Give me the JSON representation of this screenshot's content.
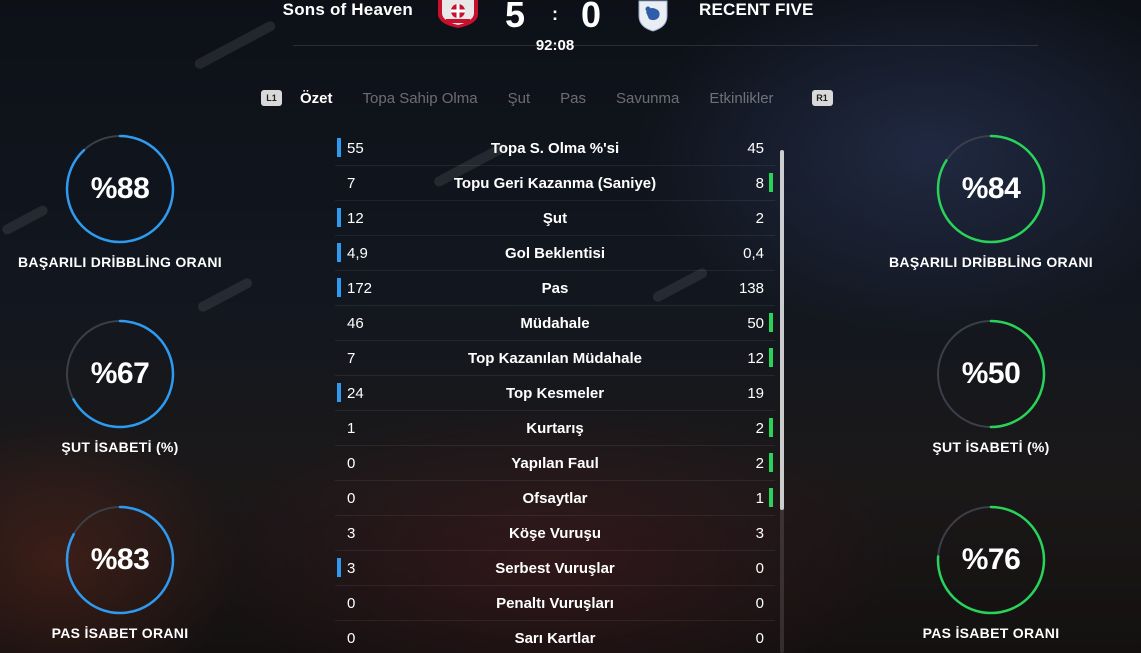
{
  "colors": {
    "home_accent": "#2e9bf0",
    "away_accent": "#29d35a",
    "ring_track": "#3a3f48"
  },
  "header": {
    "home_team": "Sons of Heaven",
    "away_team": "RECENT FIVE",
    "home_score": "5",
    "away_score": "0",
    "separator": ":",
    "clock": "92:08",
    "home_crest_icon": "bayer-leverkusen-crest-icon",
    "away_crest_icon": "shield-crest-icon"
  },
  "tabs": {
    "left_hint": "L1",
    "right_hint": "R1",
    "items": [
      {
        "label": "Özet",
        "active": true
      },
      {
        "label": "Topa Sahip Olma",
        "active": false
      },
      {
        "label": "Şut",
        "active": false
      },
      {
        "label": "Pas",
        "active": false
      },
      {
        "label": "Savunma",
        "active": false
      },
      {
        "label": "Etkinlikler",
        "active": false
      }
    ]
  },
  "home_rings": [
    {
      "value": "%88",
      "percent": 88,
      "label": "BAŞARILI DRİBBLİNG ORANI"
    },
    {
      "value": "%67",
      "percent": 67,
      "label": "ŞUT İSABETİ (%)"
    },
    {
      "value": "%83",
      "percent": 83,
      "label": "PAS İSABET ORANI"
    }
  ],
  "away_rings": [
    {
      "value": "%84",
      "percent": 84,
      "label": "BAŞARILI DRİBBLİNG ORANI"
    },
    {
      "value": "%50",
      "percent": 50,
      "label": "ŞUT İSABETİ (%)"
    },
    {
      "value": "%76",
      "percent": 76,
      "label": "PAS İSABET ORANI"
    }
  ],
  "stats": [
    {
      "home": "55",
      "name": "Topa S. Olma %'si",
      "away": "45",
      "lead": "home"
    },
    {
      "home": "7",
      "name": "Topu Geri Kazanma (Saniye)",
      "away": "8",
      "lead": "away"
    },
    {
      "home": "12",
      "name": "Şut",
      "away": "2",
      "lead": "home"
    },
    {
      "home": "4,9",
      "name": "Gol Beklentisi",
      "away": "0,4",
      "lead": "home"
    },
    {
      "home": "172",
      "name": "Pas",
      "away": "138",
      "lead": "home"
    },
    {
      "home": "46",
      "name": "Müdahale",
      "away": "50",
      "lead": "away"
    },
    {
      "home": "7",
      "name": "Top Kazanılan Müdahale",
      "away": "12",
      "lead": "away"
    },
    {
      "home": "24",
      "name": "Top Kesmeler",
      "away": "19",
      "lead": "home"
    },
    {
      "home": "1",
      "name": "Kurtarış",
      "away": "2",
      "lead": "away"
    },
    {
      "home": "0",
      "name": "Yapılan Faul",
      "away": "2",
      "lead": "away"
    },
    {
      "home": "0",
      "name": "Ofsaytlar",
      "away": "1",
      "lead": "away"
    },
    {
      "home": "3",
      "name": "Köşe Vuruşu",
      "away": "3",
      "lead": "none"
    },
    {
      "home": "3",
      "name": "Serbest Vuruşlar",
      "away": "0",
      "lead": "home"
    },
    {
      "home": "0",
      "name": "Penaltı Vuruşları",
      "away": "0",
      "lead": "none"
    },
    {
      "home": "0",
      "name": "Sarı Kartlar",
      "away": "0",
      "lead": "none"
    }
  ]
}
